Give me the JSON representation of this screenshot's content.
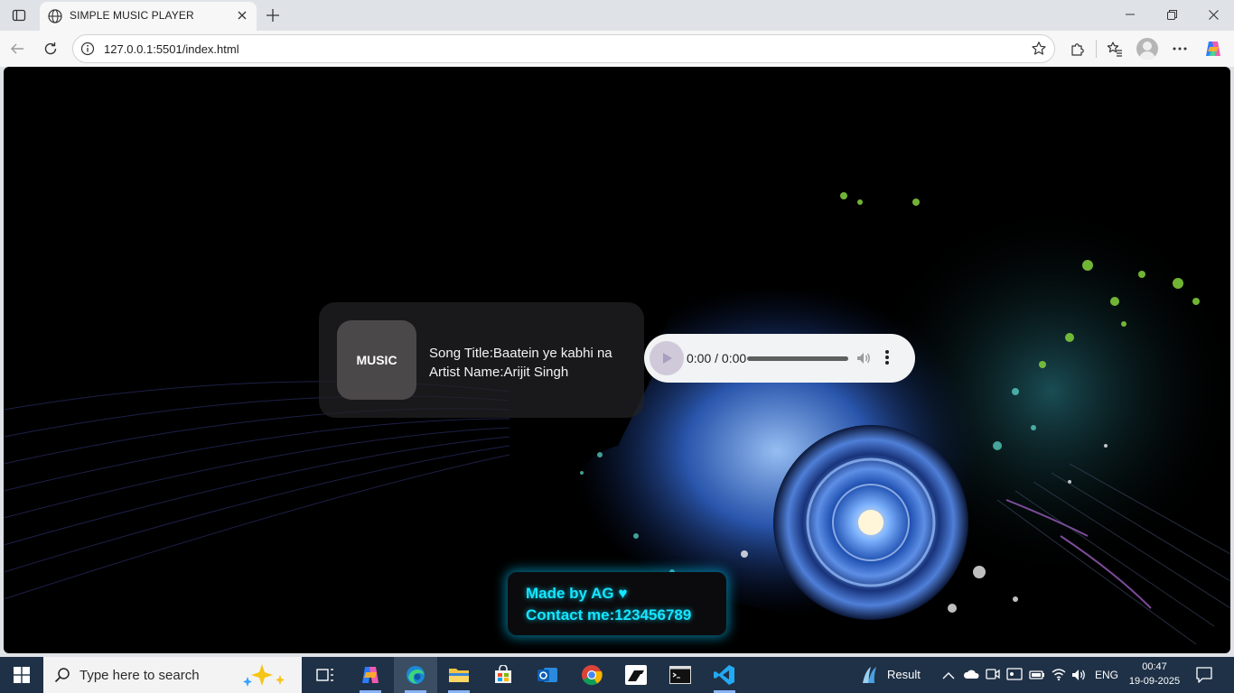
{
  "browser": {
    "tab_title": "SIMPLE MUSIC PLAYER",
    "url": "127.0.0.1:5501/index.html"
  },
  "player": {
    "cover_label": "MUSIC",
    "song_title": "Song Title:Baatein ye kabhi na",
    "artist": "Artist Name:Arijit Singh",
    "time": "0:00 / 0:00"
  },
  "footer": {
    "made_by": "Made by AG ♥",
    "contact": "Contact me:123456789"
  },
  "taskbar": {
    "search_placeholder": "Type here to search",
    "weather_label": "Result",
    "language": "ENG",
    "time": "00:47",
    "date": "19-09-2025"
  },
  "colors": {
    "accent_cyan": "#16e6ff",
    "taskbar": "#1f3147"
  }
}
